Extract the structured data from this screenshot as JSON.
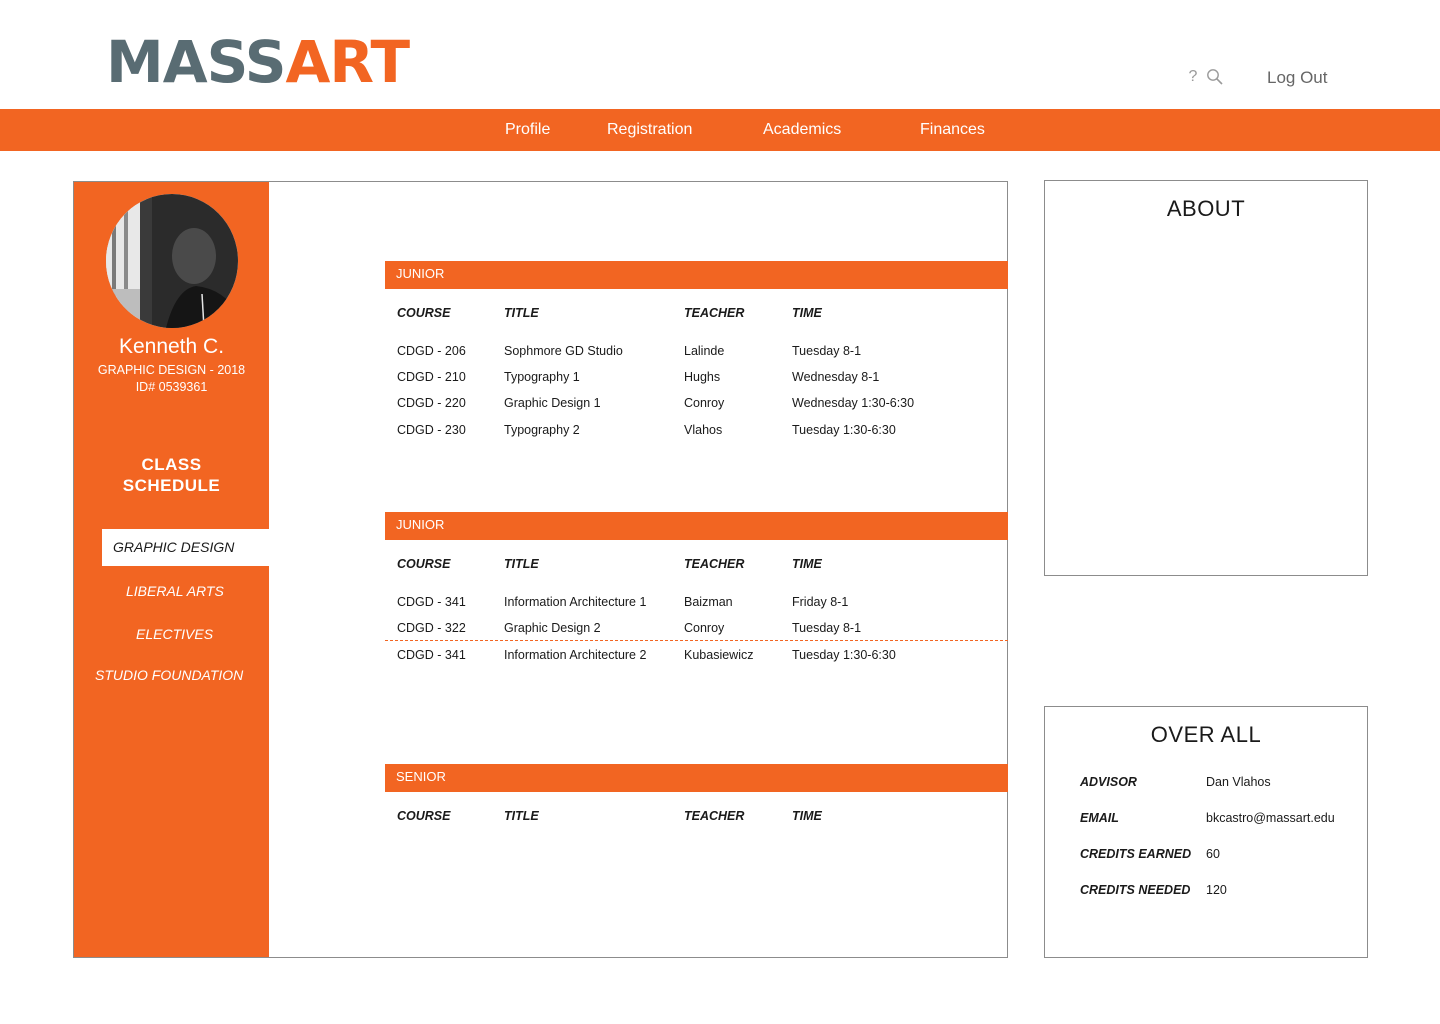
{
  "header": {
    "logo_part1": "MASS",
    "logo_part2": "ART",
    "help_label": "?",
    "logout_label": "Log Out"
  },
  "nav": {
    "items": [
      "Profile",
      "Registration",
      "Academics",
      "Finances"
    ]
  },
  "student": {
    "name": "Kenneth C.",
    "program": "GRAPHIC DESIGN - 2018",
    "id": "ID# 0539361"
  },
  "sidebar": {
    "schedule_title_line1": "CLASS",
    "schedule_title_line2": "SCHEDULE",
    "items": [
      "GRAPHIC DESIGN",
      "LIBERAL ARTS",
      "ELECTIVES",
      "STUDIO FOUNDATION"
    ]
  },
  "columns": {
    "course": "COURSE",
    "title": "TITLE",
    "teacher": "TEACHER",
    "time": "TIME"
  },
  "schedule": [
    {
      "year": "JUNIOR",
      "rows": [
        {
          "course": "CDGD - 206",
          "title": "Sophmore GD Studio",
          "teacher": "Lalinde",
          "time": "Tuesday 8-1"
        },
        {
          "course": "CDGD - 210",
          "title": "Typography 1",
          "teacher": "Hughs",
          "time": "Wednesday 8-1"
        },
        {
          "course": "CDGD - 220",
          "title": "Graphic Design 1",
          "teacher": "Conroy",
          "time": "Wednesday 1:30-6:30"
        },
        {
          "course": "CDGD - 230",
          "title": "Typography 2",
          "teacher": "Vlahos",
          "time": "Tuesday 1:30-6:30"
        }
      ]
    },
    {
      "year": "JUNIOR",
      "rows": [
        {
          "course": "CDGD - 341",
          "title": "Information Architecture 1",
          "teacher": "Baizman",
          "time": "Friday 8-1"
        },
        {
          "course": "CDGD - 322",
          "title": "Graphic Design 2",
          "teacher": "Conroy",
          "time": "Tuesday 8-1"
        },
        {
          "course": "CDGD - 341",
          "title": "Information Architecture 2",
          "teacher": "Kubasiewicz",
          "time": "Tuesday 1:30-6:30"
        }
      ]
    },
    {
      "year": "SENIOR",
      "rows": []
    }
  ],
  "about": {
    "title": "ABOUT"
  },
  "overall": {
    "title": "OVER ALL",
    "advisor_label": "ADVISOR",
    "advisor": "Dan Vlahos",
    "email_label": "EMAIL",
    "email": "bkcastro@massart.edu",
    "earned_label": "CREDITS EARNED",
    "earned": "60",
    "needed_label": "CREDITS NEEDED",
    "needed": "120"
  },
  "colors": {
    "accent": "#f26522",
    "logo_gray": "#596c73"
  }
}
